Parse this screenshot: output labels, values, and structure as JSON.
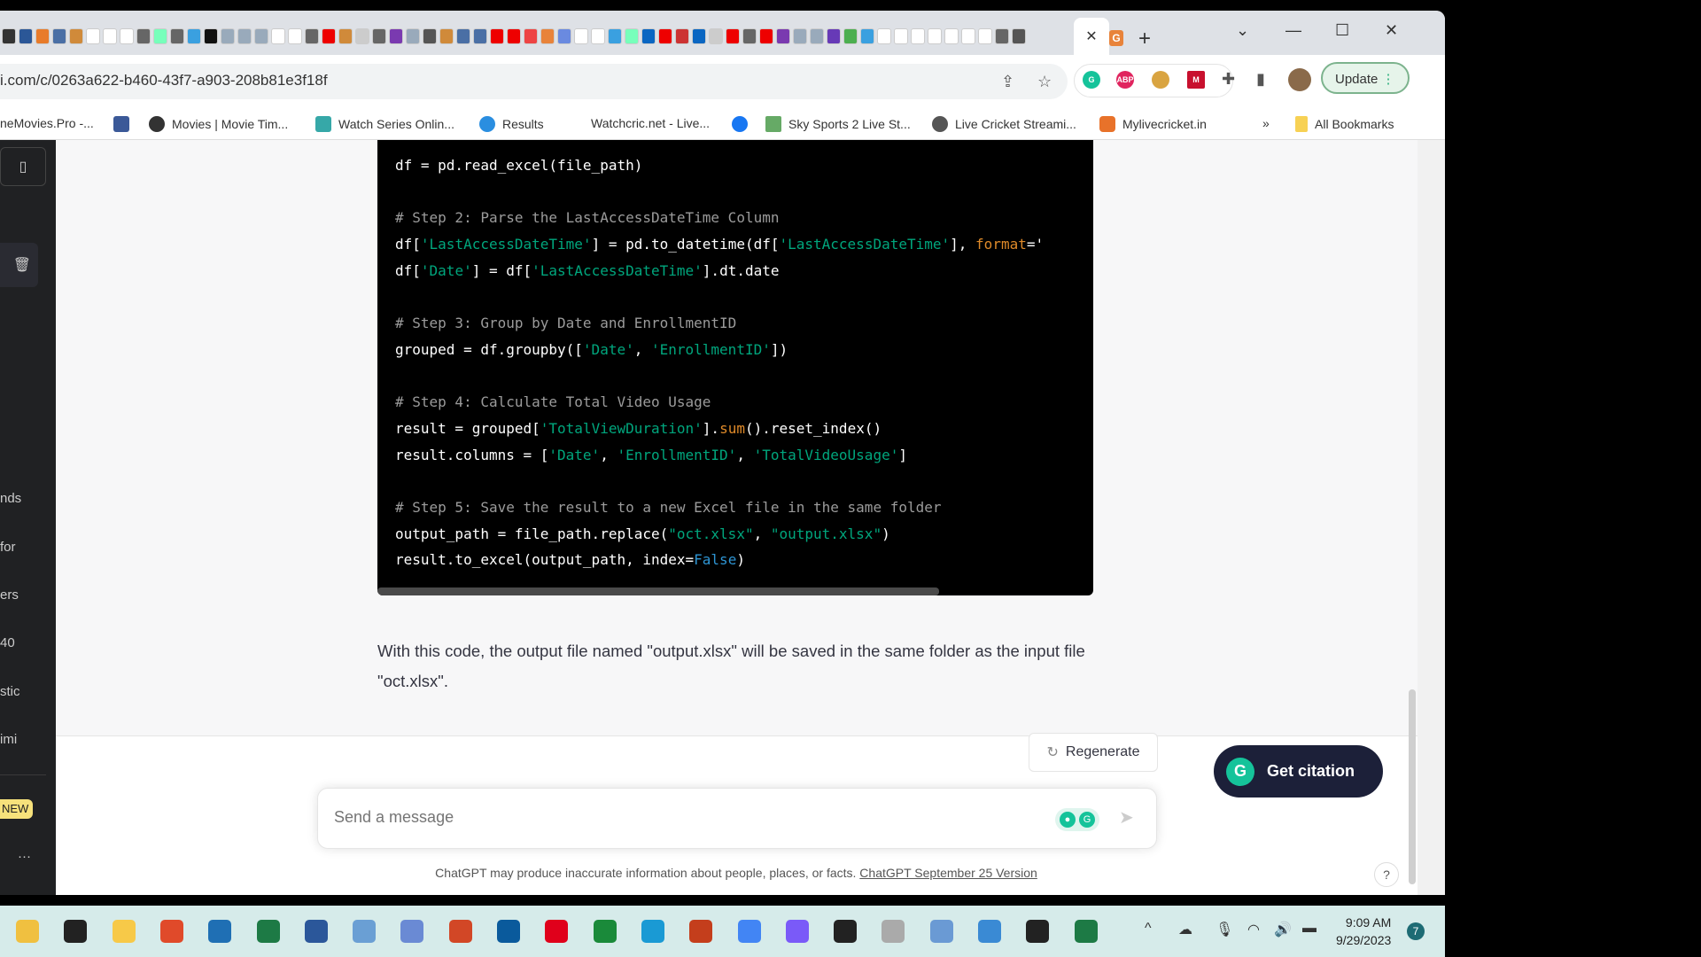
{
  "browser": {
    "url": "i.com/c/0263a622-b460-43f7-a903-208b81e3f18f",
    "update_label": "Update",
    "bookmarks": [
      "neMovies.Pro -...",
      "Movies | Movie Tim...",
      "Watch Series Onlin...",
      "Results",
      "Watchcric.net - Live...",
      "Sky Sports 2 Live St...",
      "Live Cricket Streami...",
      "Mylivecricket.in"
    ],
    "bookmarks_overflow": "»",
    "all_bookmarks": "All Bookmarks"
  },
  "sidebar": {
    "items": [
      "nds",
      "for",
      "ers",
      "40",
      "stic",
      "imi"
    ],
    "new_badge": "NEW",
    "more": "···"
  },
  "code": {
    "lines": [
      [
        [
          "",
          "df = pd.read_excel(file_path)"
        ]
      ],
      [],
      [
        [
          "cm",
          "# Step 2: Parse the LastAccessDateTime Column"
        ]
      ],
      [
        [
          "",
          "df["
        ],
        [
          "st",
          "'LastAccessDateTime'"
        ],
        [
          "",
          "] = pd.to_datetime(df["
        ],
        [
          "st",
          "'LastAccessDateTime'"
        ],
        [
          "",
          "], "
        ],
        [
          "kw",
          "format"
        ],
        [
          "",
          "='"
        ]
      ],
      [
        [
          "",
          "df["
        ],
        [
          "st",
          "'Date'"
        ],
        [
          "",
          "] = df["
        ],
        [
          "st",
          "'LastAccessDateTime'"
        ],
        [
          "",
          "].dt.date"
        ]
      ],
      [],
      [
        [
          "cm",
          "# Step 3: Group by Date and EnrollmentID"
        ]
      ],
      [
        [
          "",
          "grouped = df.groupby(["
        ],
        [
          "st",
          "'Date'"
        ],
        [
          "",
          ", "
        ],
        [
          "st",
          "'EnrollmentID'"
        ],
        [
          "",
          "])"
        ]
      ],
      [],
      [
        [
          "cm",
          "# Step 4: Calculate Total Video Usage"
        ]
      ],
      [
        [
          "",
          "result = grouped["
        ],
        [
          "st",
          "'TotalViewDuration'"
        ],
        [
          "",
          "]."
        ],
        [
          "kw",
          "sum"
        ],
        [
          "",
          "().reset_index()"
        ]
      ],
      [
        [
          "",
          "result.columns = ["
        ],
        [
          "st",
          "'Date'"
        ],
        [
          "",
          ", "
        ],
        [
          "st",
          "'EnrollmentID'"
        ],
        [
          "",
          ", "
        ],
        [
          "st",
          "'TotalVideoUsage'"
        ],
        [
          "",
          "]"
        ]
      ],
      [],
      [
        [
          "cm",
          "# Step 5: Save the result to a new Excel file in the same folder"
        ]
      ],
      [
        [
          "",
          "output_path = file_path.replace("
        ],
        [
          "st",
          "\"oct.xlsx\""
        ],
        [
          "",
          ", "
        ],
        [
          "st",
          "\"output.xlsx\""
        ],
        [
          "",
          ")"
        ]
      ],
      [
        [
          "",
          "result.to_excel(output_path, index="
        ],
        [
          "bl",
          "False"
        ],
        [
          "",
          ")"
        ]
      ]
    ]
  },
  "chat": {
    "response": "With this code, the output file named \"output.xlsx\" will be saved in the same folder as the input file \"oct.xlsx\".",
    "regenerate_label": "Regenerate",
    "get_citation_label": "Get citation",
    "input_placeholder": "Send a message",
    "disclaimer": "ChatGPT may produce inaccurate information about people, places, or facts.",
    "version_link": "ChatGPT September 25 Version",
    "help": "?"
  },
  "taskbar": {
    "time": "9:09 AM",
    "date": "9/29/2023",
    "notification_count": "7"
  },
  "colors": {
    "accent": "#15c39a",
    "code_string": "#00a67d",
    "code_keyword": "#df8a29",
    "sidebar": "#202123"
  }
}
